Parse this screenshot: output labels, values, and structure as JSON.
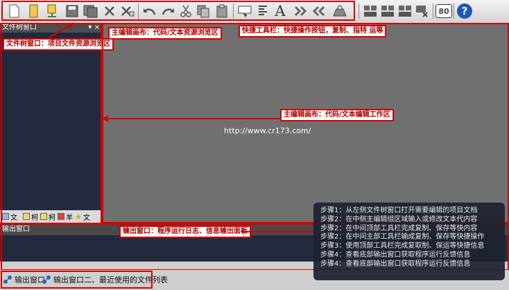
{
  "toolbar": {
    "icons": [
      "new-file-icon",
      "open-folder-icon",
      "open-project-icon",
      "save-icon",
      "save-all-icon",
      "close-icon",
      "close-all-icon",
      "undo-icon",
      "redo-icon",
      "cut-icon",
      "copy-icon",
      "paste-icon",
      "find-icon",
      "format-icon",
      "font-icon",
      "indent-icon",
      "outdent-icon",
      "compile-icon",
      "build-icon",
      "run-icon",
      "debug-icon",
      "stop-icon",
      "zoom-80-icon",
      "help-icon"
    ],
    "font_glyph": "A",
    "zoom_label": "80",
    "help_label": "?"
  },
  "left_panel": {
    "title": "文件树窗口",
    "pin": "▾",
    "close": "×",
    "tabs": [
      {
        "icon": "file-view-icon",
        "label": "文"
      },
      {
        "icon": "class-view-icon",
        "label": "柯"
      },
      {
        "icon": "resource-view-icon",
        "label": "柯"
      },
      {
        "icon": "symbol-view-icon",
        "label": "羊"
      },
      {
        "icon": "favorite-icon",
        "label": "文"
      }
    ]
  },
  "annotations": {
    "file_tree": "文件树窗口：项目文件资源浏览区",
    "editor_canvas_top": "主编辑画布：代码/文本资源浏览区",
    "quick_toolbar": "快捷工具栏：快捷操作按钮，复制、指特 运等",
    "editor_canvas_mid": "主编辑画布：代码/文本编辑工作区",
    "output": "输出窗口：程序运行日志、信息输出面板"
  },
  "main": {
    "url": "http://www.cr173.com/"
  },
  "output_panel": {
    "title": "输出窗口",
    "tabs": [
      {
        "icon": "output-icon",
        "label": "输出窗口"
      },
      {
        "icon": "output-icon",
        "label": "输出窗口二、最近使用的文件列表"
      }
    ]
  },
  "steps": [
    "步骤1：从左侧文件树窗口打开需要编辑的项目文档",
    "步骤2：在中侧主编辑组区域输入或修改文本代内容",
    "步骤2：在中间顶部工具栏完成复制、保存等快内容",
    "步骤2：在中间主部工具栏输成复制、保存等快捷操作",
    "步骤3：使用顶部工具栏完成复取制、保运等快捷信息",
    "步骤4：查看底部输出窗口获取程序运行反馈信息",
    "步骤4：查看底部输出窗口获取程序运行反馈信息"
  ]
}
